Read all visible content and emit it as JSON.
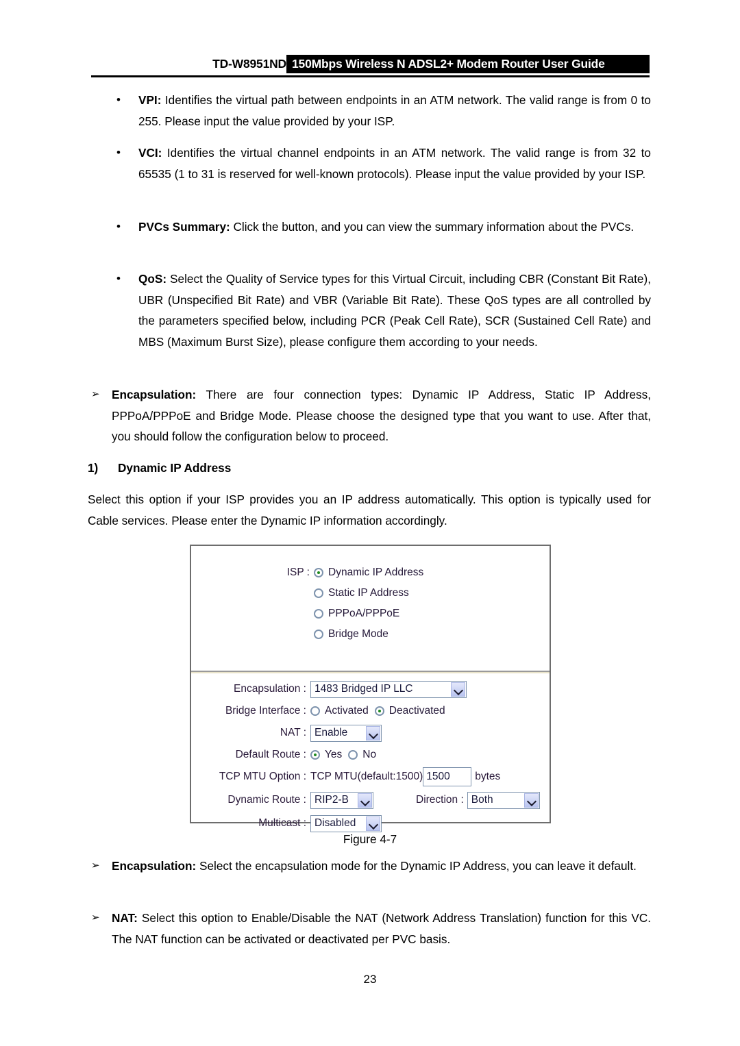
{
  "header": {
    "model": "TD-W8951ND",
    "title": "150Mbps Wireless N ADSL2+ Modem Router User Guide"
  },
  "bullets": [
    {
      "term": "VPI:",
      "text": " Identifies the virtual path between endpoints in an ATM network. The valid range is from 0 to 255. Please input the value provided by your ISP."
    },
    {
      "term": "VCI:",
      "text": " Identifies the virtual channel endpoints in an ATM network. The valid range is from 32 to 65535 (1 to 31 is reserved for well-known protocols). Please input the value provided by your ISP."
    },
    {
      "term": "PVCs Summary:",
      "text": " Click the button, and you can view the summary information about the PVCs."
    },
    {
      "term": "QoS:",
      "text": " Select the Quality of Service types for this Virtual Circuit, including CBR (Constant Bit Rate), UBR (Unspecified Bit Rate) and VBR (Variable Bit Rate). These QoS types are all controlled by the parameters specified below, including PCR (Peak Cell Rate), SCR (Sustained Cell Rate) and MBS (Maximum Burst Size), please configure them according to your needs."
    }
  ],
  "encapsulation_intro": {
    "term": "Encapsulation:",
    "text": " There are four connection types: Dynamic IP Address, Static IP Address, PPPoA/PPPoE and Bridge Mode. Please choose the designed type that you want to use. After that, you should follow the configuration below to proceed."
  },
  "section": {
    "number": "1)",
    "title": "Dynamic IP Address",
    "description": "Select this option if your ISP provides you an IP address automatically. This option is typically used for Cable services. Please enter the Dynamic IP information accordingly."
  },
  "figure": {
    "caption": "Figure 4-7",
    "isp": {
      "label": "ISP :",
      "options": [
        {
          "label": "Dynamic IP Address",
          "selected": true
        },
        {
          "label": "Static IP Address",
          "selected": false
        },
        {
          "label": "PPPoA/PPPoE",
          "selected": false
        },
        {
          "label": "Bridge Mode",
          "selected": false
        }
      ]
    },
    "form": {
      "encapsulation": {
        "label": "Encapsulation :",
        "value": "1483 Bridged IP LLC"
      },
      "bridge_interface": {
        "label": "Bridge Interface :",
        "options": [
          {
            "label": "Activated",
            "selected": false
          },
          {
            "label": "Deactivated",
            "selected": true
          }
        ]
      },
      "nat": {
        "label": "NAT :",
        "value": "Enable"
      },
      "default_route": {
        "label": "Default Route :",
        "options": [
          {
            "label": "Yes",
            "selected": true
          },
          {
            "label": "No",
            "selected": false
          }
        ]
      },
      "tcp_mtu": {
        "label": "TCP MTU Option :",
        "prefix": "TCP MTU(default:1500)",
        "value": "1500",
        "unit": "bytes"
      },
      "dynamic_route": {
        "label": "Dynamic Route :",
        "value": "RIP2-B"
      },
      "direction": {
        "label": "Direction :",
        "value": "Both"
      },
      "multicast": {
        "label": "Multicast :",
        "value": "Disabled"
      }
    }
  },
  "footer_bullets": [
    {
      "term": "Encapsulation:",
      "text": " Select the encapsulation mode for the Dynamic IP Address, you can leave it default."
    },
    {
      "term": "NAT:",
      "text": " Select this option to Enable/Disable the NAT (Network Address Translation) function for this VC. The NAT function can be activated or deactivated per PVC basis."
    }
  ],
  "page_number": "23",
  "colors": {
    "header_band": "#000000",
    "figure_border": "#6d6d6d",
    "radio_selected_dot": "#1e8a1e",
    "control_border": "#7e93ad",
    "dropdown_button": "#b9c4f0"
  }
}
